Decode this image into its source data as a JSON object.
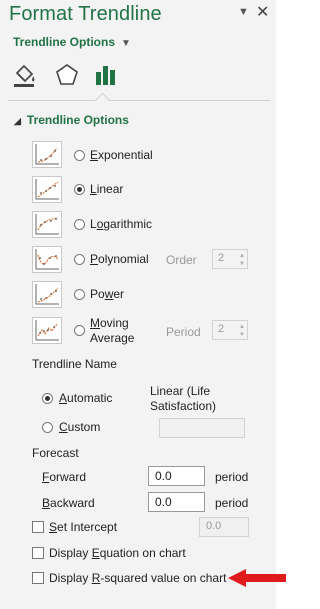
{
  "pane": {
    "title": "Format Trendline",
    "pin_icon": "pin-dropdown-icon",
    "close_icon": "close-icon",
    "options_dropdown": "Trendline Options"
  },
  "tabs": [
    {
      "name": "Fill & Line",
      "icon": "paint-bucket-icon"
    },
    {
      "name": "Effects",
      "icon": "pentagon-icon"
    },
    {
      "name": "Trendline Options",
      "icon": "bar-chart-icon",
      "active": true
    }
  ],
  "section": {
    "header": "Trendline Options",
    "types": [
      {
        "key": "E",
        "rest": "xponential",
        "selected": false
      },
      {
        "key": "L",
        "rest": "inear",
        "selected": true
      },
      {
        "pre": "L",
        "key": "o",
        "rest": "garithmic",
        "selected": false
      },
      {
        "key": "P",
        "rest": "olynomial",
        "selected": false,
        "param_label": "Order",
        "param_value": "2"
      },
      {
        "pre": "Po",
        "key": "w",
        "rest": "er",
        "selected": false
      },
      {
        "key": "M",
        "rest": "oving",
        "line2": "Average",
        "selected": false,
        "param_label": "Period",
        "param_value": "2"
      }
    ],
    "trendline_name": {
      "label": "Trendline Name",
      "automatic": {
        "key": "A",
        "rest": "utomatic",
        "selected": true,
        "value": "Linear (Life Satisfaction)"
      },
      "custom": {
        "key": "C",
        "rest": "ustom",
        "selected": false,
        "value": ""
      }
    },
    "forecast": {
      "label": "Forecast",
      "forward": {
        "key": "F",
        "rest": "orward",
        "value": "0.0",
        "unit": "period"
      },
      "backward": {
        "key": "B",
        "rest": "ackward",
        "value": "0.0",
        "unit": "period"
      }
    },
    "set_intercept": {
      "key": "S",
      "rest": "et Intercept",
      "checked": false,
      "value": "0.0"
    },
    "display_equation": {
      "pre": "Display ",
      "key": "E",
      "rest": "quation on chart",
      "checked": false
    },
    "display_rsquared": {
      "pre": "Display ",
      "key": "R",
      "rest": "-squared value on chart",
      "checked": false
    }
  },
  "colors": {
    "accent_green": "#217346",
    "annotation_arrow": "#e01b1b",
    "pane_bg": "#f3f3f3"
  }
}
